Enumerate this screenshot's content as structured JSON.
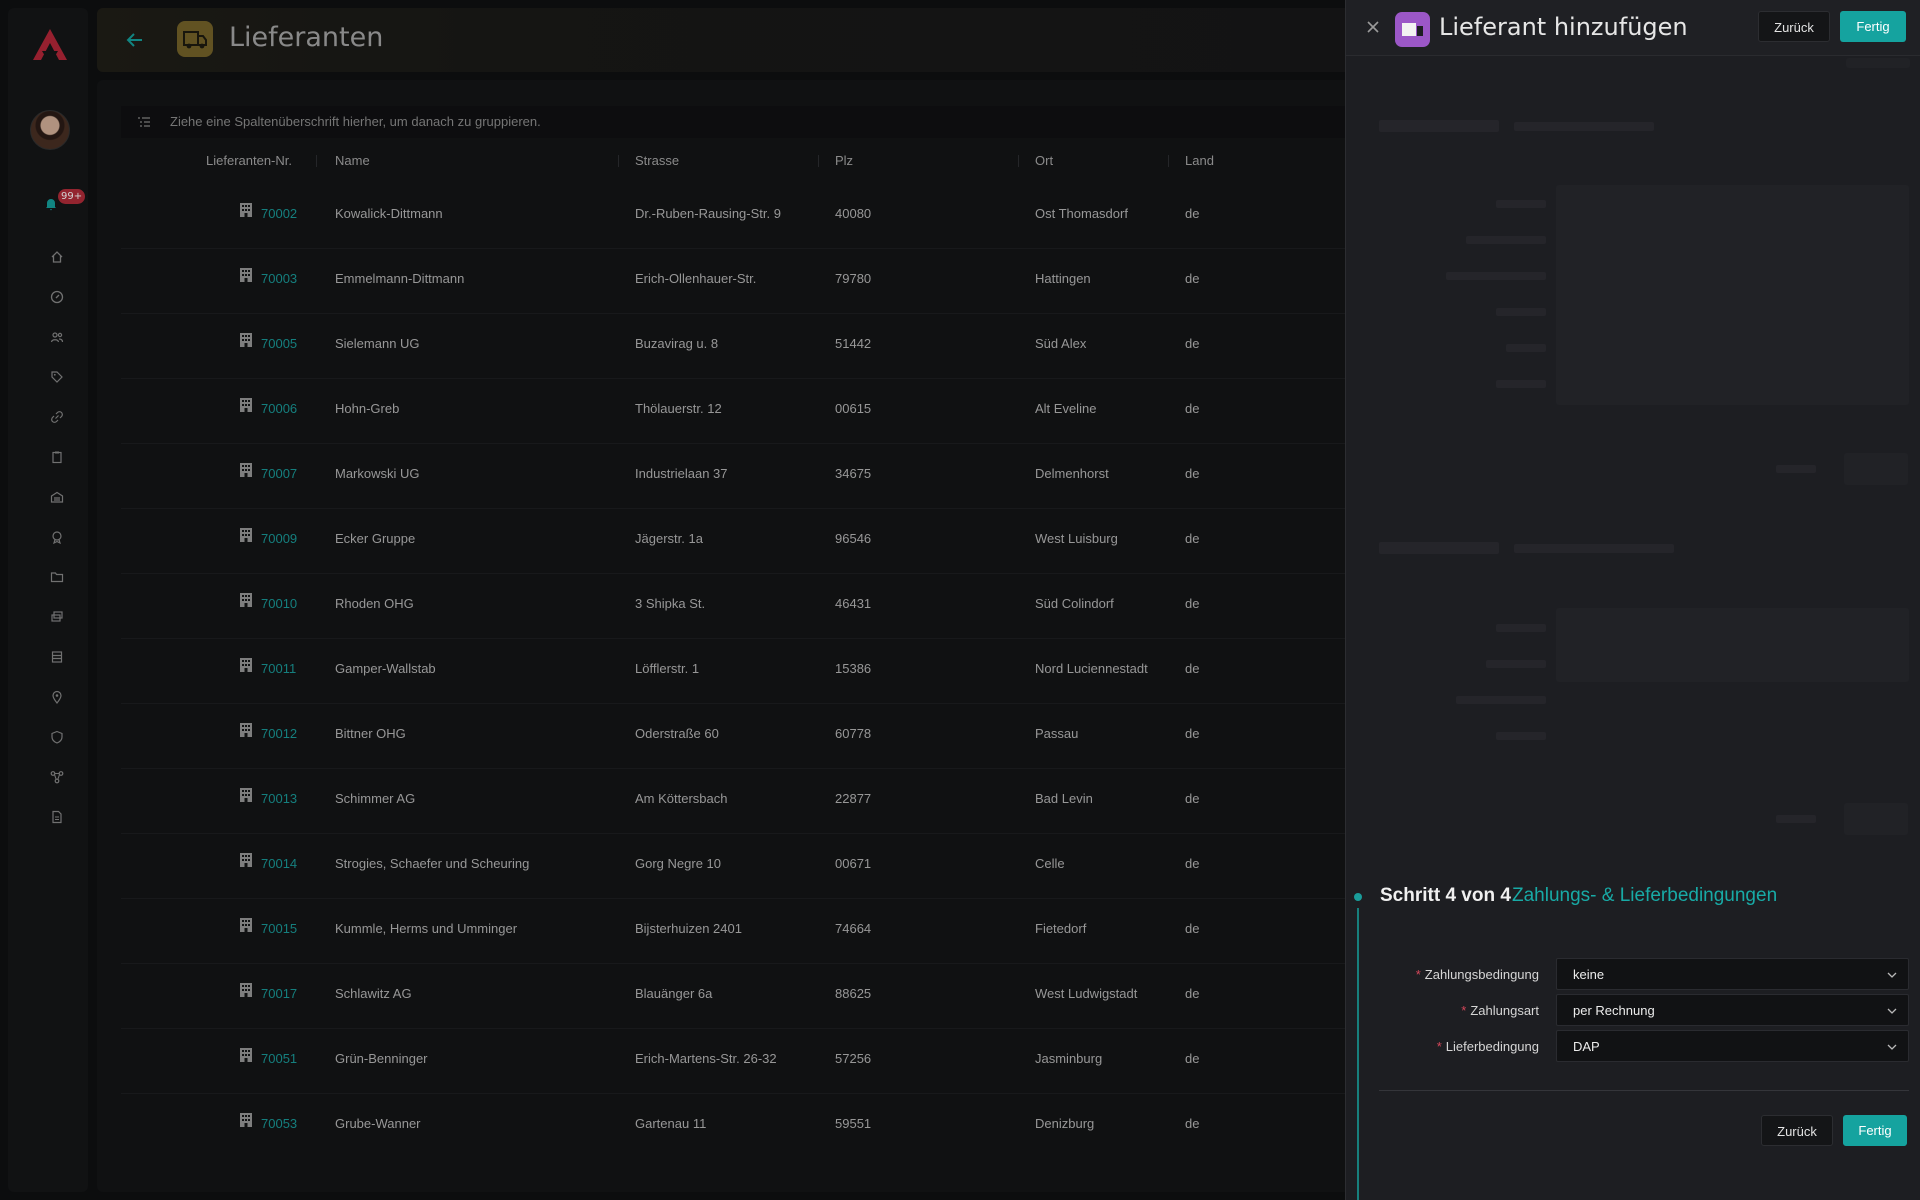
{
  "sidebar": {
    "notification_count": "99+",
    "icons": [
      "home-icon",
      "compass-icon",
      "users-icon",
      "tag-icon",
      "link-icon",
      "clipboard-icon",
      "warehouse-icon",
      "badge-icon",
      "folder-icon",
      "layers-icon",
      "archive-icon",
      "location-icon",
      "shield-icon",
      "network-icon",
      "document-icon"
    ]
  },
  "header": {
    "title": "Lieferanten"
  },
  "grouping": {
    "hint": "Ziehe eine Spaltenüberschrift hierher, um danach zu gruppieren."
  },
  "table": {
    "columns": [
      "Lieferanten-Nr.",
      "Name",
      "Strasse",
      "Plz",
      "Ort",
      "Land"
    ],
    "rows": [
      {
        "nr": "70002",
        "name": "Kowalick-Dittmann",
        "strasse": "Dr.-Ruben-Rausing-Str. 9",
        "plz": "40080",
        "ort": "Ost Thomasdorf",
        "land": "de"
      },
      {
        "nr": "70003",
        "name": "Emmelmann-Dittmann",
        "strasse": "Erich-Ollenhauer-Str.",
        "plz": "79780",
        "ort": "Hattingen",
        "land": "de"
      },
      {
        "nr": "70005",
        "name": "Sielemann UG",
        "strasse": "Buzavirag u. 8",
        "plz": "51442",
        "ort": "Süd Alex",
        "land": "de"
      },
      {
        "nr": "70006",
        "name": "Hohn-Greb",
        "strasse": "Thölauerstr. 12",
        "plz": "00615",
        "ort": "Alt Eveline",
        "land": "de"
      },
      {
        "nr": "70007",
        "name": "Markowski UG",
        "strasse": "Industrielaan 37",
        "plz": "34675",
        "ort": "Delmenhorst",
        "land": "de"
      },
      {
        "nr": "70009",
        "name": "Ecker Gruppe",
        "strasse": "Jägerstr. 1a",
        "plz": "96546",
        "ort": "West Luisburg",
        "land": "de"
      },
      {
        "nr": "70010",
        "name": "Rhoden OHG",
        "strasse": "3 Shipka St.",
        "plz": "46431",
        "ort": "Süd Colindorf",
        "land": "de"
      },
      {
        "nr": "70011",
        "name": "Gamper-Wallstab",
        "strasse": "Löfflerstr. 1",
        "plz": "15386",
        "ort": "Nord Luciennestadt",
        "land": "de"
      },
      {
        "nr": "70012",
        "name": "Bittner OHG",
        "strasse": "Oderstraße 60",
        "plz": "60778",
        "ort": "Passau",
        "land": "de"
      },
      {
        "nr": "70013",
        "name": "Schimmer AG",
        "strasse": "Am Köttersbach",
        "plz": "22877",
        "ort": "Bad Levin",
        "land": "de"
      },
      {
        "nr": "70014",
        "name": "Strogies, Schaefer und Scheuring",
        "strasse": "Gorg Negre 10",
        "plz": "00671",
        "ort": "Celle",
        "land": "de"
      },
      {
        "nr": "70015",
        "name": "Kummle, Herms und Umminger",
        "strasse": "Bijsterhuizen 2401",
        "plz": "74664",
        "ort": "Fietedorf",
        "land": "de"
      },
      {
        "nr": "70017",
        "name": "Schlawitz AG",
        "strasse": "Blauänger 6a",
        "plz": "88625",
        "ort": "West Ludwigstadt",
        "land": "de"
      },
      {
        "nr": "70051",
        "name": "Grün-Benninger",
        "strasse": "Erich-Martens-Str. 26-32",
        "plz": "57256",
        "ort": "Jasminburg",
        "land": "de"
      },
      {
        "nr": "70053",
        "name": "Grube-Wanner",
        "strasse": "Gartenau 11",
        "plz": "59551",
        "ort": "Denizburg",
        "land": "de"
      }
    ]
  },
  "drawer": {
    "title": "Lieferant hinzufügen",
    "back_label": "Zurück",
    "done_label": "Fertig",
    "step_prefix": "Schritt 4 von 4",
    "step_title": "Zahlungs- & Lieferbedingungen",
    "fields": [
      {
        "label": "Zahlungsbedingung",
        "value": "keine"
      },
      {
        "label": "Zahlungsart",
        "value": "per Rechnung"
      },
      {
        "label": "Lieferbedingung",
        "value": "DAP"
      }
    ],
    "footer_back_label": "Zurück",
    "footer_done_label": "Fertig"
  },
  "colors": {
    "accent": "#15a39f",
    "badge": "#b42d3a",
    "drawer_icon": "#9b57c7",
    "page_icon": "#77652a"
  }
}
